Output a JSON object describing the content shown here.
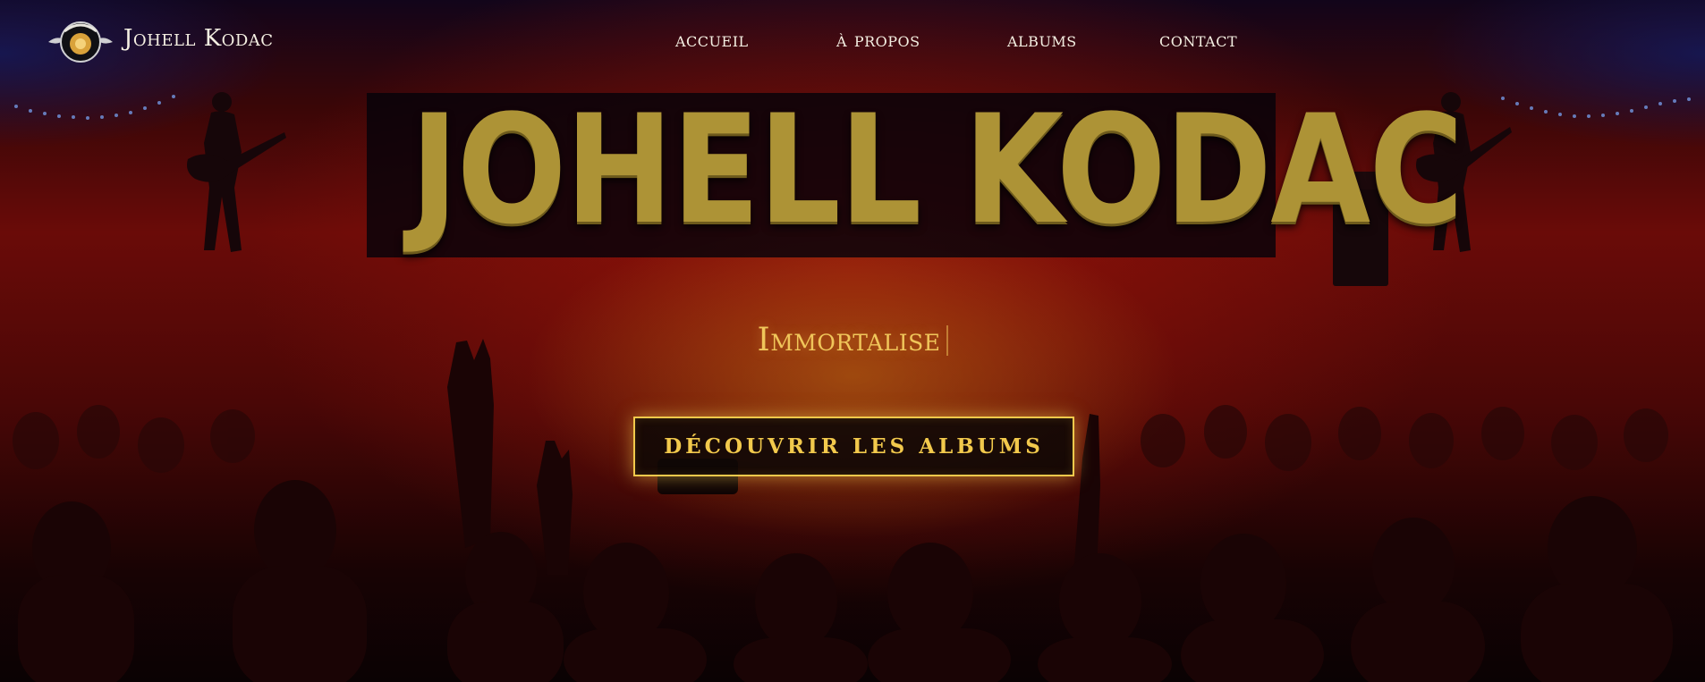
{
  "header": {
    "brand_name": "Johell Kodac",
    "logo_icon": "band-logo-emblem-icon",
    "nav": [
      {
        "label": "ACCUEIL"
      },
      {
        "label": "À PROPOS"
      },
      {
        "label": "ALBUMS"
      },
      {
        "label": "CONTACT"
      }
    ]
  },
  "hero": {
    "title": "JOHELL KODAC",
    "tagline": "Immortalise",
    "cta_label": "DÉCOUVRIR LES ALBUMS",
    "background_icon": "concert-crowd-background"
  },
  "colors": {
    "gold": "#ad9336",
    "accent": "#f2c94c",
    "text": "#f4efe2",
    "deep_red": "#6a0b08",
    "stage_blue": "#14195a"
  }
}
